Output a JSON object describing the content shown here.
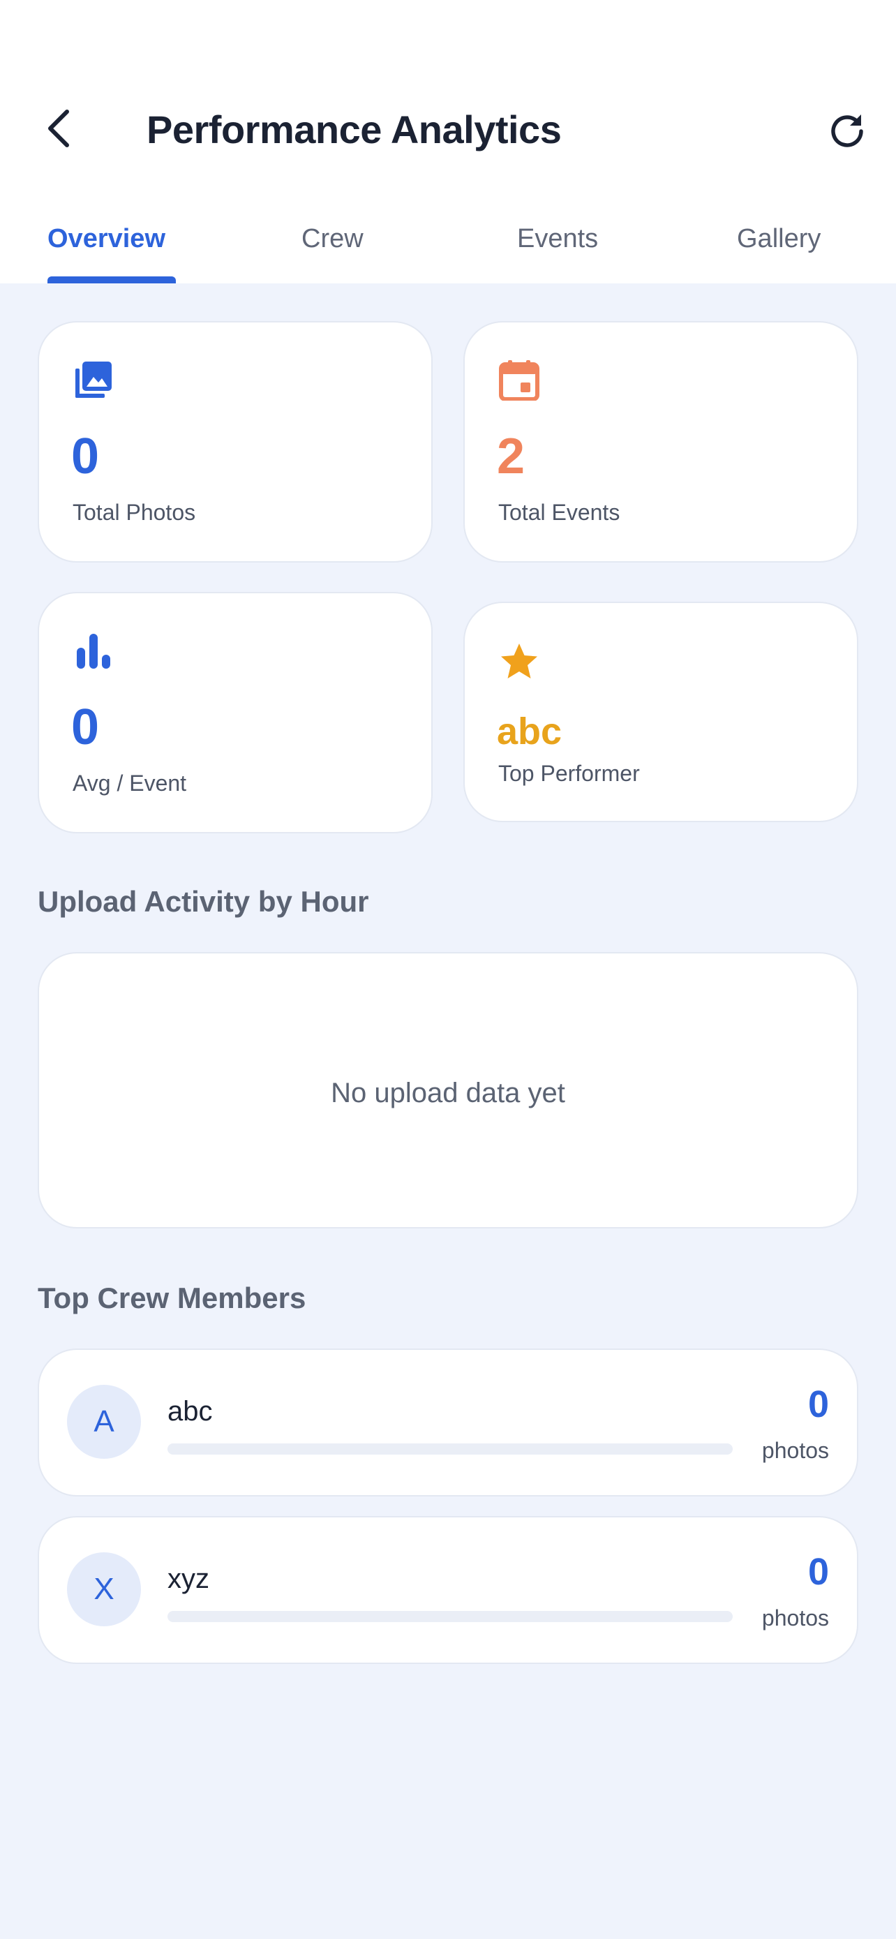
{
  "header": {
    "title": "Performance Analytics",
    "back_icon": "chevron-left-icon",
    "refresh_icon": "refresh-icon"
  },
  "tabs": [
    {
      "label": "Overview",
      "active": true
    },
    {
      "label": "Crew",
      "active": false
    },
    {
      "label": "Events",
      "active": false
    },
    {
      "label": "Gallery",
      "active": false
    }
  ],
  "stats": [
    {
      "icon": "photo-library-icon",
      "value": "0",
      "label": "Total Photos",
      "color": "#2d63db"
    },
    {
      "icon": "calendar-icon",
      "value": "2",
      "label": "Total Events",
      "color": "#f0845c"
    },
    {
      "icon": "bar-chart-icon",
      "value": "0",
      "label": "Avg / Event",
      "color": "#2d63db"
    },
    {
      "icon": "star-icon",
      "value": "abc",
      "label": "Top Performer",
      "color": "#e8a31c"
    }
  ],
  "upload_activity": {
    "title": "Upload Activity by Hour",
    "empty_message": "No upload data yet"
  },
  "top_crew": {
    "title": "Top Crew Members",
    "members": [
      {
        "initial": "A",
        "name": "abc",
        "count": "0",
        "unit": "photos",
        "progress": 0
      },
      {
        "initial": "X",
        "name": "xyz",
        "count": "0",
        "unit": "photos",
        "progress": 0
      }
    ]
  },
  "colors": {
    "accent": "#2d63db",
    "events": "#f0845c",
    "performer": "#e8a31c",
    "background": "#eff3fc"
  }
}
